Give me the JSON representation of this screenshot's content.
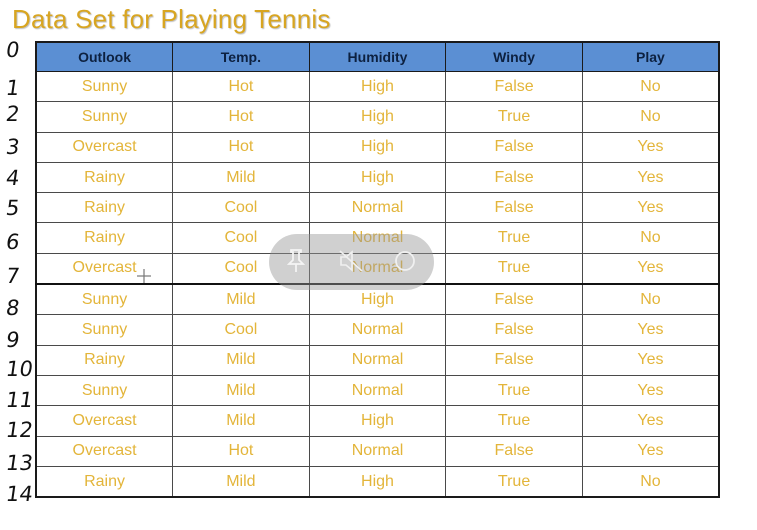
{
  "title": "Data Set for Playing Tennis",
  "columns": [
    "Outlook",
    "Temp.",
    "Humidity",
    "Windy",
    "Play"
  ],
  "rows": [
    [
      "Sunny",
      "Hot",
      "High",
      "False",
      "No"
    ],
    [
      "Sunny",
      "Hot",
      "High",
      "True",
      "No"
    ],
    [
      "Overcast",
      "Hot",
      "High",
      "False",
      "Yes"
    ],
    [
      "Rainy",
      "Mild",
      "High",
      "False",
      "Yes"
    ],
    [
      "Rainy",
      "Cool",
      "Normal",
      "False",
      "Yes"
    ],
    [
      "Rainy",
      "Cool",
      "Normal",
      "True",
      "No"
    ],
    [
      "Overcast",
      "Cool",
      "Normal",
      "True",
      "Yes"
    ],
    [
      "Sunny",
      "Mild",
      "High",
      "False",
      "No"
    ],
    [
      "Sunny",
      "Cool",
      "Normal",
      "False",
      "Yes"
    ],
    [
      "Rainy",
      "Mild",
      "Normal",
      "False",
      "Yes"
    ],
    [
      "Sunny",
      "Mild",
      "Normal",
      "True",
      "Yes"
    ],
    [
      "Overcast",
      "Mild",
      "High",
      "True",
      "Yes"
    ],
    [
      "Overcast",
      "Hot",
      "Normal",
      "False",
      "Yes"
    ],
    [
      "Rainy",
      "Mild",
      "High",
      "True",
      "No"
    ]
  ],
  "handwritten_row_numbers": [
    "0",
    "1",
    "2",
    "3",
    "4",
    "5",
    "6",
    "7",
    "8",
    "9",
    "10",
    "11",
    "12",
    "13",
    "14"
  ],
  "overlay_controls": {
    "icons": [
      "pin-icon",
      "mute-icon",
      "record-icon"
    ]
  },
  "colors": {
    "title": "#d8a521",
    "header_bg": "#5b8fd3",
    "header_text": "#0d2140",
    "cell_text": "#e3b53a"
  }
}
